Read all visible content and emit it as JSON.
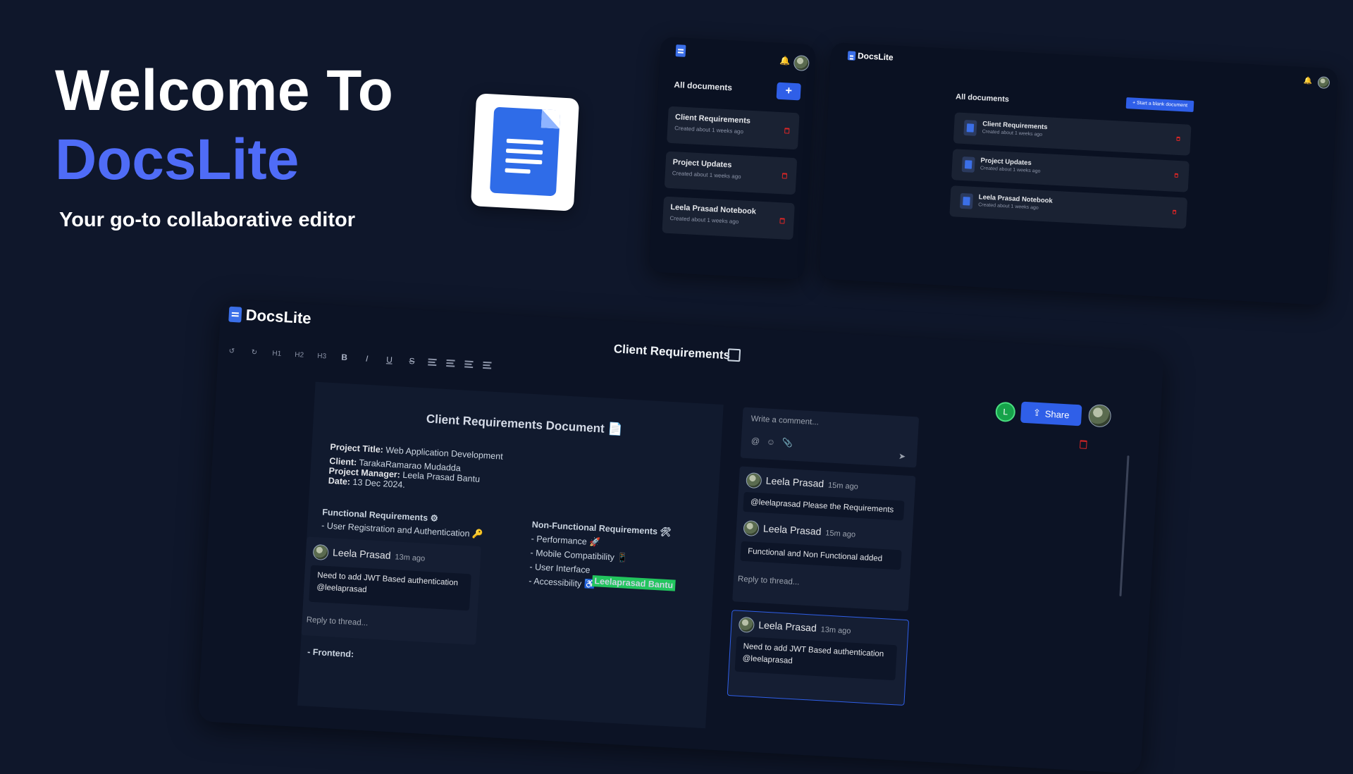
{
  "hero": {
    "title": "Welcome To",
    "brand": "DocsLite",
    "subtitle": "Your go-to collaborative editor"
  },
  "mobile": {
    "heading": "All documents",
    "add_label": "+",
    "docs": [
      {
        "title": "Client Requirements",
        "meta": "Created about 1 weeks ago"
      },
      {
        "title": "Project Updates",
        "meta": "Created about 1 weeks ago"
      },
      {
        "title": "Leela Prasad Notebook",
        "meta": "Created about 1 weeks ago"
      }
    ]
  },
  "desktop": {
    "brand": "DocsLite",
    "heading": "All documents",
    "new_doc_label": "+ Start a blank document",
    "docs": [
      {
        "title": "Client Requirements",
        "meta": "Created about 1 weeks ago"
      },
      {
        "title": "Project Updates",
        "meta": "Created about 1 weeks ago"
      },
      {
        "title": "Leela Prasad Notebook",
        "meta": "Created about 1 weeks ago"
      }
    ]
  },
  "editor": {
    "brand": "DocsLite",
    "doc_title": "Client Requirements",
    "toolbar": [
      "↺",
      "↻",
      "H1",
      "H2",
      "H3",
      "B",
      "I",
      "U",
      "S"
    ],
    "user_initial": "L",
    "share_label": "Share",
    "document": {
      "heading": "Client Requirements Document 📄",
      "project_title_label": "Project Title:",
      "project_title": " Web Application Development",
      "client_label": "Client:",
      "client": " TarakaRamarao Mudadda",
      "manager_label": "Project Manager:",
      "manager": " Leela Prasad Bantu",
      "date_label": "Date:",
      "date": " 13 Dec 2024.",
      "functional_heading": "Functional Requirements ⚙",
      "functional_item": "- User Registration and Authentication 🔑",
      "nonfunctional_heading": "Non-Functional Requirements 🛠",
      "nf_items": [
        "- Performance 🚀",
        "- Mobile Compatibility 📱",
        "- User Interface",
        "- Accessibility ♿"
      ],
      "cursor_label": "Leelaprasad Bantu",
      "frontend": "- Frontend:"
    },
    "inline_thread": {
      "name": "Leela Prasad",
      "ago": "13m ago",
      "message": "Need to add JWT Based authentication @leelaprasad",
      "reply_placeholder": "Reply to thread..."
    },
    "comment_box": {
      "placeholder": "Write a comment...",
      "icons": [
        "@",
        "☺",
        "📎"
      ],
      "send": "➤"
    },
    "side_thread": {
      "c1_name": "Leela Prasad",
      "c1_ago": "15m ago",
      "c1_msg": "@leelaprasad  Please the Requirements",
      "c2_name": "Leela Prasad",
      "c2_ago": "15m ago",
      "c2_msg": "Functional and Non Functional added",
      "reply_placeholder": "Reply to thread..."
    },
    "side_thread2": {
      "name": "Leela Prasad",
      "ago": "13m ago",
      "message": "Need to add JWT Based authentication @leelaprasad"
    }
  }
}
